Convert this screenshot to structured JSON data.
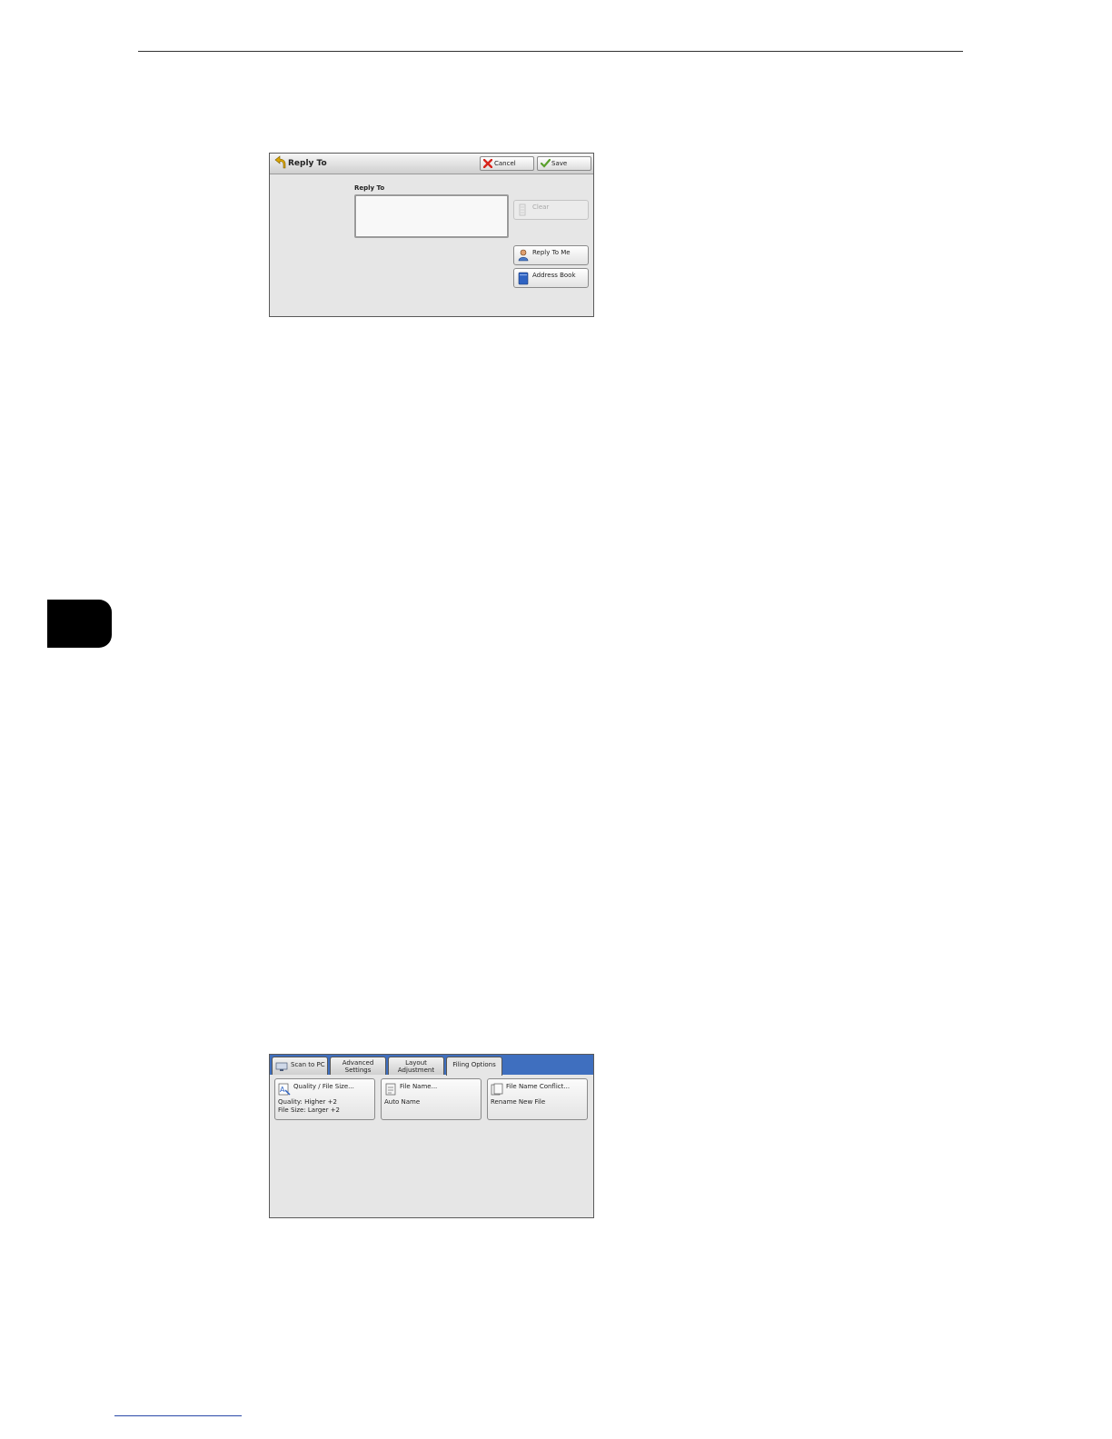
{
  "reply_to_screen": {
    "title": "Reply To",
    "cancel_label": "Cancel",
    "save_label": "Save",
    "field_label": "Reply To",
    "field_value": "",
    "clear_label": "Clear",
    "reply_to_me_label": "Reply To Me",
    "address_book_label": "Address Book"
  },
  "filing_screen": {
    "tabs": [
      {
        "line1": "Scan to PC",
        "line2": ""
      },
      {
        "line1": "Advanced",
        "line2": "Settings"
      },
      {
        "line1": "Layout",
        "line2": "Adjustment"
      },
      {
        "line1": "Filing Options",
        "line2": ""
      }
    ],
    "active_tab": "Filing Options",
    "tiles": [
      {
        "title": "Quality / File Size...",
        "value1": "Quality: Higher +2",
        "value2": "File Size: Larger +2"
      },
      {
        "title": "File Name...",
        "value1": "Auto Name",
        "value2": ""
      },
      {
        "title": "File Name Conflict...",
        "value1": "Rename New File",
        "value2": ""
      }
    ]
  },
  "colors": {
    "tab_strip": "#3f6fbf",
    "screen_bg": "#e6e6e6",
    "chapter_tab": "#000000"
  }
}
